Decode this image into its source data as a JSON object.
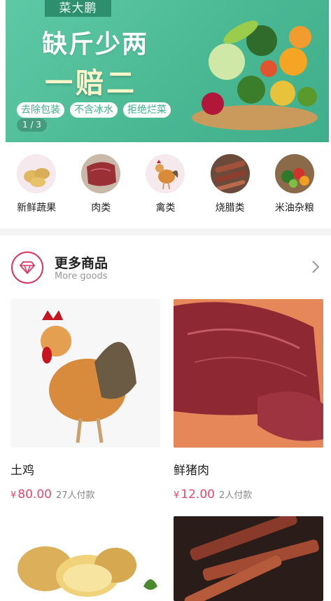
{
  "banner": {
    "brand": "菜大鹏",
    "headline": "缺斤少两",
    "subline": "一赔二",
    "tags": [
      "去除包装",
      "不含冰水",
      "拒绝烂菜"
    ],
    "pager": "1 / 3"
  },
  "categories": [
    {
      "label": "新鲜蔬果",
      "icon": "potato-icon"
    },
    {
      "label": "肉类",
      "icon": "meat-icon"
    },
    {
      "label": "禽类",
      "icon": "rooster-icon"
    },
    {
      "label": "烧腊类",
      "icon": "cured-meat-icon"
    },
    {
      "label": "米油杂粮",
      "icon": "vegetables-icon"
    }
  ],
  "section": {
    "title": "更多商品",
    "subtitle": "More goods",
    "icon": "diamond-icon",
    "accent": "#d9355f"
  },
  "products": [
    {
      "name": "土鸡",
      "currency": "¥",
      "price": "80.00",
      "paid": "27人付款"
    },
    {
      "name": "鲜猪肉",
      "currency": "¥",
      "price": "12.00",
      "paid": "2人付款"
    },
    {
      "name": "",
      "currency": "",
      "price": "",
      "paid": ""
    },
    {
      "name": "",
      "currency": "",
      "price": "",
      "paid": ""
    }
  ],
  "colors": {
    "banner_green": "#49b792",
    "price_red": "#e44a6c"
  }
}
